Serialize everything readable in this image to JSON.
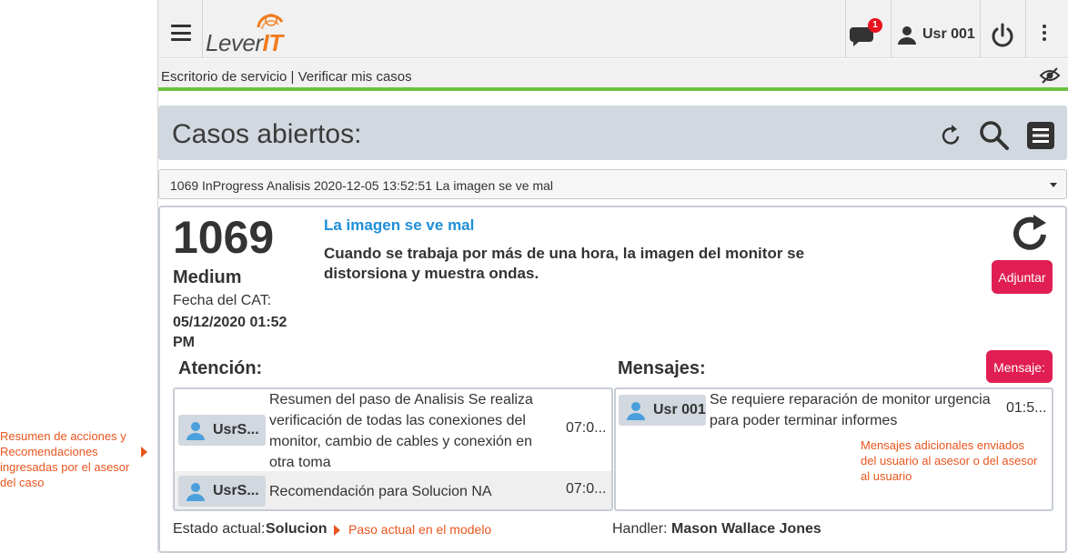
{
  "annotations": {
    "left_note": "Resumen de acciones y Recomendaciones ingresadas por el asesor del caso",
    "messages_note": "Mensajes adicionales enviados del usuario al asesor o del asesor al usuario",
    "state_note": "Paso actual en el modelo"
  },
  "header": {
    "logo_text_a": "Lever",
    "logo_text_b": "IT",
    "notifications_count": "1",
    "user_name": "Usr 001"
  },
  "breadcrumb": "Escritorio de servicio | Verificar mis casos",
  "cases": {
    "title": "Casos abiertos:",
    "selected": "1069 InProgress Analisis 2020-12-05 13:52:51 La imagen se ve mal"
  },
  "case": {
    "number": "1069",
    "priority": "Medium",
    "date_label": "Fecha del CAT:",
    "date_value": "05/12/2020 01:52 PM",
    "subject": "La imagen se ve mal",
    "description": "Cuando se trabaja por más de una hora, la imagen del monitor se distorsiona y muestra ondas.",
    "attach_label": "Adjuntar",
    "message_label": "Mensaje:"
  },
  "attention": {
    "title": "Atención:",
    "rows": [
      {
        "user": "UsrS...",
        "text": "Resumen del paso de Analisis Se realiza verificación de todas las conexiones del monitor, cambio de cables y conexión en otra toma",
        "time": "07:0..."
      },
      {
        "user": "UsrS...",
        "text": "Recomendación para Solucion NA",
        "time": "07:0..."
      }
    ]
  },
  "messages": {
    "title": "Mensajes:",
    "rows": [
      {
        "user": "Usr 001",
        "text": "Se requiere reparación de monitor urgencia para poder terminar informes",
        "time": "01:5..."
      }
    ]
  },
  "status": {
    "label": "Estado actual:",
    "value": "Solucion"
  },
  "handler": {
    "label": "Handler:",
    "value": "Mason Wallace Jones"
  },
  "colors": {
    "accent_green": "#6cc33e",
    "accent_red": "#e11e53",
    "link_blue": "#1e8fd6",
    "note_orange": "#e8551e"
  }
}
